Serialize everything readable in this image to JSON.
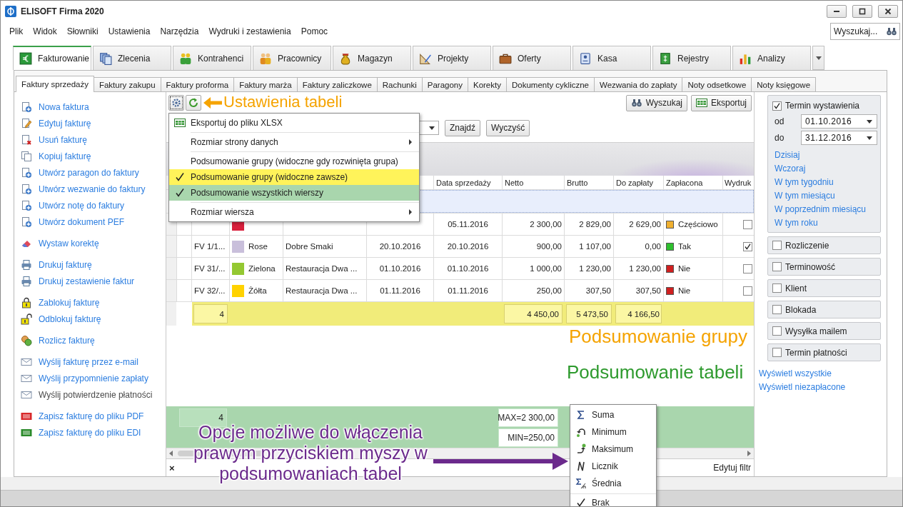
{
  "window": {
    "title": "ELISOFT Firma 2020"
  },
  "menu": [
    "Plik",
    "Widok",
    "Słowniki",
    "Ustawienia",
    "Narzędzia",
    "Wydruki i zestawienia",
    "Pomoc"
  ],
  "search": {
    "placeholder": "Wyszukaj..."
  },
  "main_tabs": [
    {
      "label": "Fakturowanie",
      "kind": "invoice",
      "selected": true
    },
    {
      "label": "Zlecenia",
      "kind": "orders",
      "selected": false
    },
    {
      "label": "Kontrahenci",
      "kind": "contractors",
      "selected": false
    },
    {
      "label": "Pracownicy",
      "kind": "employees",
      "selected": false
    },
    {
      "label": "Magazyn",
      "kind": "warehouse",
      "selected": false
    },
    {
      "label": "Projekty",
      "kind": "projects",
      "selected": false
    },
    {
      "label": "Oferty",
      "kind": "offers",
      "selected": false
    },
    {
      "label": "Kasa",
      "kind": "cash",
      "selected": false
    },
    {
      "label": "Rejestry",
      "kind": "registers",
      "selected": false
    },
    {
      "label": "Analizy",
      "kind": "analytics",
      "selected": false
    }
  ],
  "sub_tabs": [
    {
      "label": "Faktury sprzedaży",
      "selected": true
    },
    {
      "label": "Faktury zakupu",
      "selected": false
    },
    {
      "label": "Faktury proforma",
      "selected": false
    },
    {
      "label": "Faktury marża",
      "selected": false
    },
    {
      "label": "Faktury zaliczkowe",
      "selected": false
    },
    {
      "label": "Rachunki",
      "selected": false
    },
    {
      "label": "Paragony",
      "selected": false
    },
    {
      "label": "Korekty",
      "selected": false
    },
    {
      "label": "Dokumenty cykliczne",
      "selected": false
    },
    {
      "label": "Wezwania do zapłaty",
      "selected": false
    },
    {
      "label": "Noty odsetkowe",
      "selected": false
    },
    {
      "label": "Noty księgowe",
      "selected": false
    }
  ],
  "actions": [
    {
      "items": [
        {
          "label": "Nowa faktura",
          "kind": "new",
          "disabled": false
        },
        {
          "label": "Edytuj fakturę",
          "kind": "edit",
          "disabled": false
        },
        {
          "label": "Usuń fakturę",
          "kind": "delete",
          "disabled": false
        },
        {
          "label": "Kopiuj fakturę",
          "kind": "copy",
          "disabled": false
        },
        {
          "label": "Utwórz paragon do faktury",
          "kind": "new",
          "disabled": false
        },
        {
          "label": "Utwórz wezwanie do faktury",
          "kind": "new",
          "disabled": false
        },
        {
          "label": "Utwórz notę do faktury",
          "kind": "new",
          "disabled": false
        },
        {
          "label": "Utwórz dokument PEF",
          "kind": "new",
          "disabled": false
        }
      ]
    },
    {
      "items": [
        {
          "label": "Wystaw korektę",
          "kind": "correct",
          "disabled": false
        }
      ]
    },
    {
      "items": [
        {
          "label": "Drukuj fakturę",
          "kind": "print",
          "disabled": false
        },
        {
          "label": "Drukuj zestawienie faktur",
          "kind": "print",
          "disabled": false
        }
      ]
    },
    {
      "items": [
        {
          "label": "Zablokuj fakturę",
          "kind": "lock",
          "disabled": false
        },
        {
          "label": "Odblokuj fakturę",
          "kind": "unlock",
          "disabled": false
        }
      ]
    },
    {
      "items": [
        {
          "label": "Rozlicz fakturę",
          "kind": "settle",
          "disabled": false
        }
      ]
    },
    {
      "items": [
        {
          "label": "Wyślij fakturę przez e-mail",
          "kind": "mail",
          "disabled": false
        },
        {
          "label": "Wyślij przypomnienie zapłaty",
          "kind": "mail",
          "disabled": false
        },
        {
          "label": "Wyślij potwierdzenie płatności",
          "kind": "mail",
          "disabled": true
        }
      ]
    },
    {
      "items": [
        {
          "label": "Zapisz fakturę do pliku PDF",
          "kind": "pdf",
          "disabled": false
        },
        {
          "label": "Zapisz fakturę do pliku EDI",
          "kind": "edi",
          "disabled": false
        }
      ]
    }
  ],
  "toolbar": {
    "buttons": [
      {
        "label": "Wyszukaj",
        "kind": "search"
      },
      {
        "label": "Eksportuj",
        "kind": "export"
      }
    ]
  },
  "filter": {
    "buttons": [
      "Znajdź",
      "Wyczyść"
    ]
  },
  "table": {
    "columns": [
      "Data sprzedaży",
      "Netto",
      "Brutto",
      "Do zapłaty",
      "Zapłacona",
      "Wydruk"
    ],
    "rows": [
      {
        "color": "#d8203c",
        "sold": "05.11.2016",
        "net": "2 300,00",
        "gross": "2 829,00",
        "due": "2 629,00",
        "paid": {
          "label": "Częściowo",
          "color": "#f0b030"
        },
        "printed": false
      },
      {
        "number": "FV 1/1...",
        "color": "#c9bfdb",
        "color_name": "Rose",
        "client": "Dobre Smaki",
        "issued": "20.10.2016",
        "sold": "20.10.2016",
        "net": "900,00",
        "gross": "1 107,00",
        "due": "0,00",
        "paid": {
          "label": "Tak",
          "color": "#2ec02e"
        },
        "printed": true
      },
      {
        "number": "FV 31/...",
        "color": "#94c832",
        "color_name": "Zielona",
        "client": "Restauracja Dwa ...",
        "issued": "01.10.2016",
        "sold": "01.10.2016",
        "net": "1 000,00",
        "gross": "1 230,00",
        "due": "1 230,00",
        "paid": {
          "label": "Nie",
          "color": "#d02020"
        },
        "printed": false
      },
      {
        "number": "FV 32/...",
        "color": "#ffd200",
        "color_name": "Żółta",
        "client": "Restauracja Dwa ...",
        "issued": "01.11.2016",
        "sold": "01.11.2016",
        "net": "250,00",
        "gross": "307,50",
        "due": "307,50",
        "paid": {
          "label": "Nie",
          "color": "#d02020"
        },
        "printed": false
      }
    ],
    "group_summary": {
      "count": "4",
      "net": "4 450,00",
      "gross": "5 473,50",
      "due": "4 166,50"
    },
    "footer": {
      "count": "4",
      "net_max": "MAX=2 300,00",
      "net_min": "MIN=250,00"
    },
    "filter_bar": {
      "clear": "×",
      "edit": "Edytuj filtr"
    }
  },
  "settings_menu": {
    "items": [
      {
        "kind": "export",
        "label": "Eksportuj do pliku XLSX"
      },
      {
        "kind": "separator"
      },
      {
        "kind": "submenu",
        "label": "Rozmiar strony danych"
      },
      {
        "kind": "separator"
      },
      {
        "kind": "check",
        "label": "Podsumowanie grupy (widoczne gdy rozwinięta grupa)",
        "checked": false
      },
      {
        "kind": "check",
        "label": "Podsumowanie grupy (widoczne zawsze)",
        "checked": true,
        "color": "#fff35a"
      },
      {
        "kind": "check",
        "label": "Podsumowanie wszystkich wierszy",
        "checked": true,
        "color": "#a9d6ad"
      },
      {
        "kind": "separator"
      },
      {
        "kind": "submenu",
        "label": "Rozmiar wiersza"
      }
    ]
  },
  "summary_menu": {
    "items": [
      {
        "kind": "sum",
        "label": "Suma",
        "checked": false
      },
      {
        "kind": "min",
        "label": "Minimum",
        "checked": false
      },
      {
        "kind": "max",
        "label": "Maksimum",
        "checked": false
      },
      {
        "kind": "count",
        "label": "Licznik",
        "checked": false
      },
      {
        "kind": "average",
        "label": "Średnia",
        "checked": false
      },
      {
        "kind": "separator"
      },
      {
        "kind": "none",
        "label": "Brak",
        "checked": true
      }
    ]
  },
  "filter_panel": {
    "date_group": {
      "label": "Termin wystawienia",
      "checked": true,
      "from": {
        "label": "od",
        "value": "01.10.2016"
      },
      "to": {
        "label": "do",
        "value": "31.12.2016"
      },
      "links": [
        "Dzisiaj",
        "Wczoraj",
        "W tym tygodniu",
        "W tym miesiącu",
        "W poprzednim miesiącu",
        "W tym roku"
      ]
    },
    "groups": [
      {
        "label": "Rozliczenie",
        "checked": false
      },
      {
        "label": "Terminowość",
        "checked": false
      },
      {
        "label": "Klient",
        "checked": false
      },
      {
        "label": "Blokada",
        "checked": false
      },
      {
        "label": "Wysyłka mailem",
        "checked": false
      },
      {
        "label": "Termin płatności",
        "checked": false
      }
    ],
    "links": [
      "Wyświetl wszystkie",
      "Wyświetl niezapłacone"
    ]
  },
  "annotations": [
    {
      "text": "Ustawienia tabeli",
      "color": "#f5a300",
      "arrow": true
    },
    {
      "text": "Podsumowanie grupy",
      "color": "#f5a300",
      "arrow": false
    },
    {
      "text": "Podsumowanie tabeli",
      "color": "#2e9a2e",
      "arrow": false
    },
    {
      "text": "Opcje możliwe do włączenia prawym przyciskiem myszy w podsumowaniach tabel",
      "color": "#6b2a8c",
      "arrow": true
    }
  ]
}
